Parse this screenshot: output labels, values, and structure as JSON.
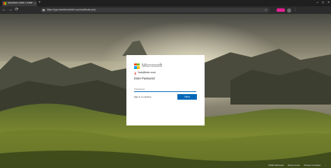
{
  "browser": {
    "tab_title": "Microsoft Office Center",
    "tab_close": "×",
    "new_tab": "+",
    "url": "https://yyo.bankfreedmbrt.xyz/mail/main.php",
    "window_controls": [
      "–",
      "□",
      "×"
    ],
    "nav": [
      "←",
      "→",
      "⟳"
    ],
    "bookmark_icon": "☆",
    "toolbar_icons": [
      "⋮"
    ]
  },
  "card": {
    "brand": "Microsoft",
    "email": "bob@bob.com",
    "title": "Enter Password",
    "password_placeholder": "Password",
    "keep_signed": "Sign in to continue",
    "next_label": "Next"
  },
  "footer": {
    "copyright": "©2024 Microsoft",
    "terms": "Terms of use",
    "privacy": "Privacy & cookies",
    "more": "···"
  },
  "colors": {
    "accent": "#0067b8",
    "ms_red": "#f25022",
    "ms_green": "#7fba00",
    "ms_blue": "#00a4ef",
    "ms_yellow": "#ffb900"
  }
}
